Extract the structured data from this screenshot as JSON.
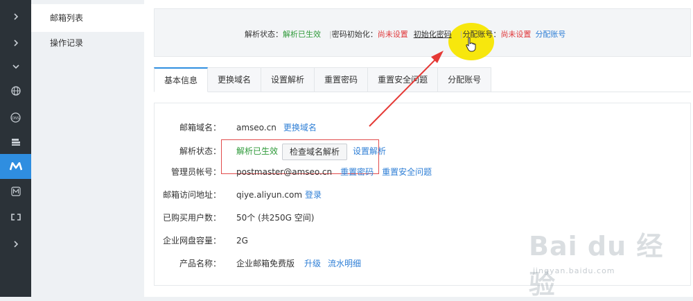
{
  "rail": {
    "items": [
      {
        "icon": "chevron-right-icon"
      },
      {
        "icon": "chevron-right-icon"
      },
      {
        "icon": "caret-down-icon"
      },
      {
        "icon": "globe-icon"
      },
      {
        "icon": "dns-icon",
        "text": "DNS"
      },
      {
        "icon": "server-icon"
      },
      {
        "icon": "mail-brand-icon",
        "text": "M"
      },
      {
        "icon": "mail-box-icon"
      },
      {
        "icon": "bracket-icon"
      },
      {
        "icon": "chevron-right-icon"
      }
    ],
    "active_index": 6
  },
  "subnav": {
    "items": [
      {
        "label": "邮箱列表"
      },
      {
        "label": "操作记录"
      }
    ]
  },
  "status": {
    "resolve_label": "解析状态：",
    "resolve_value": "解析已生效",
    "pw_label": "密码初始化：",
    "pw_value": "尚未设置",
    "pw_link": "初始化密码",
    "acct_label": "分配账号：",
    "acct_value": "尚未设置",
    "acct_link": "分配账号"
  },
  "tabs": [
    {
      "label": "基本信息",
      "active": true
    },
    {
      "label": "更换域名"
    },
    {
      "label": "设置解析"
    },
    {
      "label": "重置密码"
    },
    {
      "label": "重置安全问题"
    },
    {
      "label": "分配账号"
    }
  ],
  "info": {
    "domain_label": "邮箱域名：",
    "domain_value": "amseo.cn",
    "domain_link": "更换域名",
    "resolve_label": "解析状态：",
    "resolve_value": "解析已生效",
    "check_button": "检查域名解析",
    "set_resolve_link": "设置解析",
    "admin_label": "管理员帐号：",
    "admin_value": "postmaster@amseo.cn",
    "reset_pw_link": "重置密码",
    "reset_sec_link": "重置安全问题",
    "access_label": "邮箱访问地址：",
    "access_value": "qiye.aliyun.com",
    "login_link": "登录",
    "users_label": "已购买用户数：",
    "users_value": "50个 (共250G 空间)",
    "disk_label": "企业网盘容量：",
    "disk_value": "2G",
    "product_label": "产品名称：",
    "product_value": "企业邮箱免费版",
    "upgrade_link": "升级",
    "flow_link": "流水明细"
  },
  "watermark": {
    "logo": "Bai du 经验",
    "url": "jingyan.baidu.com"
  },
  "colors": {
    "rail_bg": "#2b3238",
    "active_blue": "#2f8ee0",
    "ok_green": "#2f9a3a",
    "warn_red": "#e0373a",
    "link_blue": "#2f7fd6",
    "highlight_yellow": "#f7e600"
  }
}
